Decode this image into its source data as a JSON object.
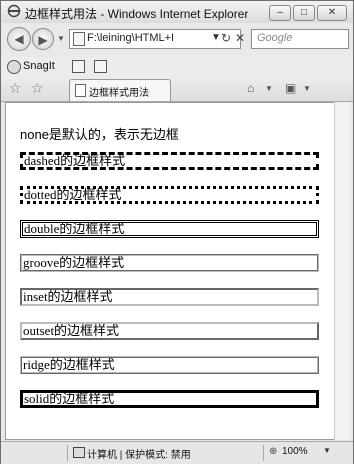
{
  "window": {
    "title": "边框样式用法 - Windows Internet Explorer",
    "controls": {
      "minimize": "–",
      "maximize": "□",
      "close": "✕"
    }
  },
  "address_bar": {
    "url": "F:\\leining\\HTML+I",
    "search_placeholder": "Google"
  },
  "snagit_bar": {
    "label": "SnagIt"
  },
  "tab": {
    "label": "边框样式用法"
  },
  "content": {
    "lines": [
      {
        "style": "none",
        "label": "none是默认的，表示无边框"
      },
      {
        "style": "dashed",
        "label": "dashed的边框样式"
      },
      {
        "style": "dotted",
        "label": "dotted的边框样式"
      },
      {
        "style": "double",
        "label": "double的边框样式"
      },
      {
        "style": "groove",
        "label": "groove的边框样式"
      },
      {
        "style": "inset",
        "label": "inset的边框样式"
      },
      {
        "style": "outset",
        "label": "outset的边框样式"
      },
      {
        "style": "ridge",
        "label": "ridge的边框样式"
      },
      {
        "style": "solid",
        "label": "solid的边框样式"
      }
    ]
  },
  "status_bar": {
    "zone": "计算机 | 保护模式: 禁用",
    "zoom": "100%"
  },
  "icons": [
    "ie-icon",
    "back-icon",
    "forward-icon",
    "page-icon",
    "refresh-icon",
    "stop-icon",
    "snagit-icon",
    "favorites-star-icon",
    "add-favorites-icon",
    "home-icon",
    "feeds-icon",
    "computer-icon",
    "zoom-icon"
  ]
}
